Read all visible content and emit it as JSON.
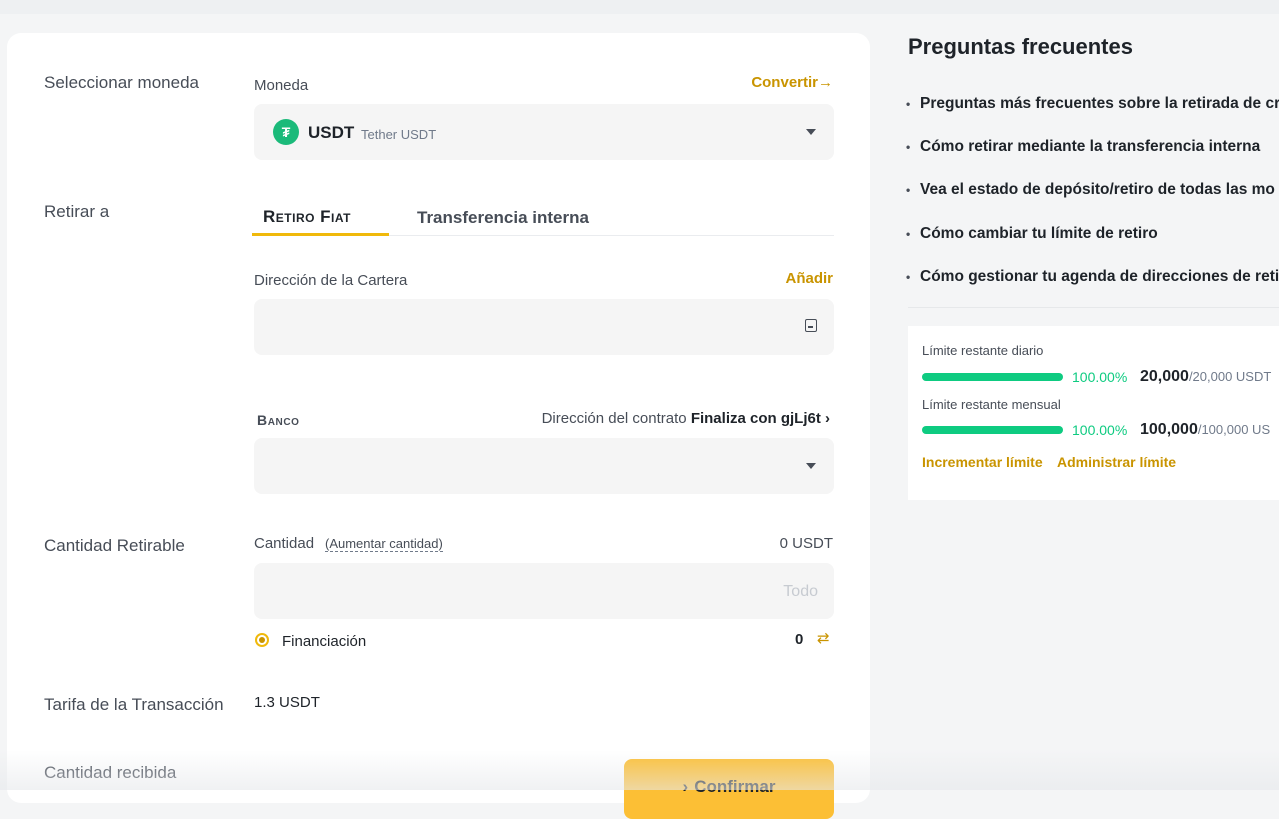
{
  "form": {
    "select_coin_label": "Seleccionar moneda",
    "coin_field_label": "Moneda",
    "convert_link": "Convertir→",
    "coin": {
      "symbol": "USDT",
      "name": "Tether USDT",
      "icon": "tether-icon",
      "glyph": "₮"
    },
    "withdraw_to_label": "Retirar a",
    "tabs": [
      {
        "label": "Retiro Fiat",
        "active": true
      },
      {
        "label": "Transferencia interna",
        "active": false
      }
    ],
    "wallet_address_label": "Dirección de la Cartera",
    "add_link": "Añadir",
    "wallet_address_value": "",
    "bank_label": "Banco",
    "contract_label": "Dirección del contrato",
    "contract_value": "Finaliza con gjLj6t",
    "bank_value": "",
    "withdrawable_label": "Cantidad Retirable",
    "amount_label": "Cantidad",
    "increase_amount_link": "(Aumentar cantidad)",
    "available": "0 USDT",
    "amount_placeholder": "Todo",
    "funding_label": "Financiación",
    "funding_value": "0",
    "fee_label": "Tarifa de la Transacción",
    "fee_value": "1.3 USDT",
    "received_label": "Cantidad recibida",
    "confirm_button": "Confirmar"
  },
  "faq": {
    "title": "Preguntas frecuentes",
    "items": [
      "Preguntas más frecuentes sobre la retirada de cr",
      "Cómo retirar mediante la transferencia interna",
      "Vea el estado de depósito/retiro de todas las mo",
      "Cómo cambiar tu límite de retiro",
      "Cómo gestionar tu agenda de direcciones de reti"
    ]
  },
  "limits": {
    "daily_label": "Límite restante diario",
    "daily_pct": "100.00%",
    "daily_fraction": 1.0,
    "daily_amount": "20,000",
    "daily_total": "/20,000 USDT",
    "monthly_label": "Límite restante mensual",
    "monthly_pct": "100.00%",
    "monthly_fraction": 1.0,
    "monthly_amount": "100,000",
    "monthly_total": "/100,000 US",
    "increase_link": "Incrementar límite",
    "manage_link": "Administrar límite"
  },
  "colors": {
    "accent": "#c99400",
    "success": "#0ecb81",
    "button": "#fcbf35"
  }
}
